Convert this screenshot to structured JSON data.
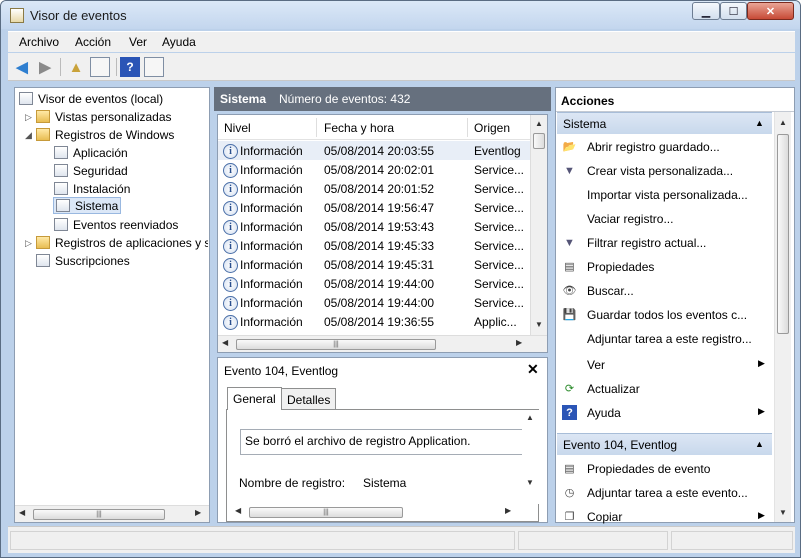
{
  "window": {
    "title": "Visor de eventos"
  },
  "menu": [
    "Archivo",
    "Acción",
    "Ver",
    "Ayuda"
  ],
  "tree": {
    "items": [
      {
        "label": "Visor de eventos (local)",
        "icon": "event-viewer-icon"
      },
      {
        "label": "Vistas personalizadas",
        "icon": "folder-icon"
      },
      {
        "label": "Registros de Windows",
        "icon": "folder-icon"
      },
      {
        "label": "Aplicación",
        "icon": "log-icon"
      },
      {
        "label": "Seguridad",
        "icon": "log-icon"
      },
      {
        "label": "Instalación",
        "icon": "log-icon"
      },
      {
        "label": "Sistema",
        "icon": "log-icon"
      },
      {
        "label": "Eventos reenviados",
        "icon": "log-icon"
      },
      {
        "label": "Registros de aplicaciones y s",
        "icon": "folder-icon"
      },
      {
        "label": "Suscripciones",
        "icon": "subscription-icon"
      }
    ]
  },
  "center": {
    "title": "Sistema",
    "event_count": "Número de eventos: 432",
    "columns": [
      "Nivel",
      "Fecha y hora",
      "Origen"
    ],
    "rows": [
      [
        "Información",
        "05/08/2014 20:03:55",
        "Eventlog"
      ],
      [
        "Información",
        "05/08/2014 20:02:01",
        "Service..."
      ],
      [
        "Información",
        "05/08/2014 20:01:52",
        "Service..."
      ],
      [
        "Información",
        "05/08/2014 19:56:47",
        "Service..."
      ],
      [
        "Información",
        "05/08/2014 19:53:43",
        "Service..."
      ],
      [
        "Información",
        "05/08/2014 19:45:33",
        "Service..."
      ],
      [
        "Información",
        "05/08/2014 19:45:31",
        "Service..."
      ],
      [
        "Información",
        "05/08/2014 19:44:00",
        "Service..."
      ],
      [
        "Información",
        "05/08/2014 19:44:00",
        "Service..."
      ],
      [
        "Información",
        "05/08/2014 19:36:55",
        "Applic..."
      ]
    ]
  },
  "detail": {
    "title": "Evento 104, Eventlog",
    "close": "✕",
    "tabs": [
      "General",
      "Detalles"
    ],
    "message": "Se borró el archivo de registro Application.",
    "field_label": "Nombre de registro:",
    "field_value": "Sistema"
  },
  "actions": {
    "header": "Acciones",
    "section1": "Sistema",
    "items1": [
      {
        "label": "Abrir registro guardado...",
        "icon": "open-folder-icon"
      },
      {
        "label": "Crear vista personalizada...",
        "icon": "filter-icon"
      },
      {
        "label": "Importar vista personalizada...",
        "icon": ""
      },
      {
        "label": "Vaciar registro...",
        "icon": ""
      },
      {
        "label": "Filtrar registro actual...",
        "icon": "filter-icon"
      },
      {
        "label": "Propiedades",
        "icon": "properties-icon"
      },
      {
        "label": "Buscar...",
        "icon": "binoculars-icon"
      },
      {
        "label": "Guardar todos los eventos c...",
        "icon": "save-icon"
      },
      {
        "label": "Adjuntar tarea a este registro...",
        "icon": ""
      },
      {
        "label": "Ver",
        "icon": "",
        "submenu": true
      },
      {
        "label": "Actualizar",
        "icon": "refresh-icon"
      },
      {
        "label": "Ayuda",
        "icon": "help-icon",
        "submenu": true
      }
    ],
    "section2": "Evento 104, Eventlog",
    "items2": [
      {
        "label": "Propiedades de evento",
        "icon": "properties-icon"
      },
      {
        "label": "Adjuntar tarea a este evento...",
        "icon": "task-icon"
      },
      {
        "label": "Copiar",
        "icon": "copy-icon",
        "submenu": true
      }
    ]
  }
}
